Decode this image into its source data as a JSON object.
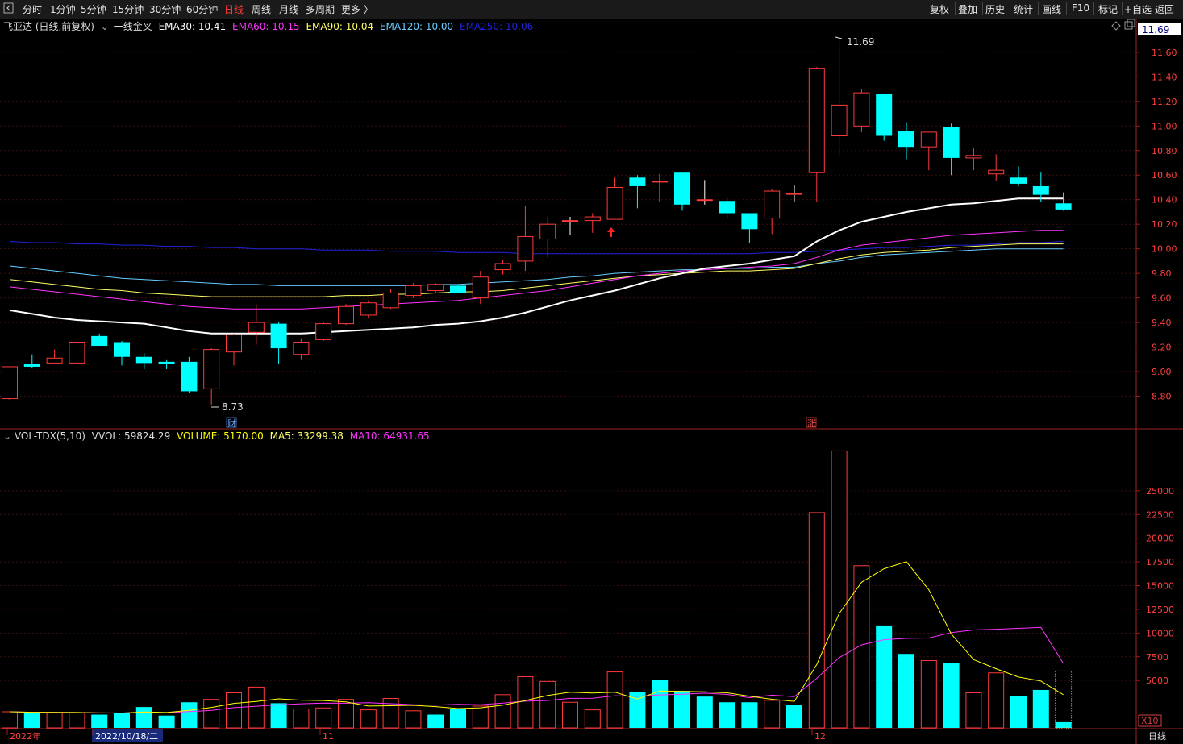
{
  "toolbar": {
    "back_icon": "square-back-icon",
    "tabs": [
      "分时",
      "1分钟",
      "5分钟",
      "15分钟",
      "30分钟",
      "60分钟",
      "日线",
      "周线",
      "月线",
      "多周期",
      "更多 〉"
    ],
    "active_tab": "日线",
    "right_buttons": [
      "复权",
      "叠加",
      "历史",
      "统计",
      "画线",
      "F10",
      "标记",
      "+自选",
      "返回"
    ]
  },
  "main_legend": {
    "stock": "飞亚达 (日线,前复权)",
    "indicator": "一线金叉",
    "ema30": "EMA30: 10.41",
    "ema60": "EMA60: 10.15",
    "ema90": "EMA90: 10.04",
    "ema120": "EMA120: 10.00",
    "ema250": "EMA250: 10.06"
  },
  "vol_legend": {
    "name": "VOL-TDX(5,10)",
    "vvol": "VVOL: 59824.29",
    "volume": "VOLUME: 5170.00",
    "ma5": "MA5: 33299.38",
    "ma10": "MA10: 64931.65"
  },
  "price_axis": {
    "current": "11.69",
    "ticks": [
      "11.60",
      "11.40",
      "11.20",
      "11.00",
      "10.80",
      "10.60",
      "10.40",
      "10.20",
      "10.00",
      "9.80",
      "9.60",
      "9.40",
      "9.20",
      "9.00",
      "8.80"
    ]
  },
  "vol_axis": {
    "ticks": [
      "25000",
      "22500",
      "20000",
      "17500",
      "15000",
      "12500",
      "10000",
      "7500",
      "5000"
    ],
    "unit": "X10"
  },
  "date_axis": {
    "labels": [
      "2022年",
      "2022/10/18/二",
      "11",
      "12"
    ],
    "period": "日线"
  },
  "annotations": {
    "high_label": "11.69",
    "low_label": "8.73",
    "marker_cai": "财",
    "marker_zhang": "涨",
    "diamond_icon": "diamond-icon",
    "window_icon": "restore-window-icon"
  },
  "colors": {
    "up": "#ff3b3b",
    "down": "#00ffff",
    "ema30": "#ffffff",
    "ema60": "#ff33ff",
    "ema90": "#ffff66",
    "ema120": "#66ccff",
    "ema250": "#2222dd",
    "ma5": "#ffff00",
    "ma10": "#ff33ff"
  },
  "chart_data": [
    {
      "type": "candlestick",
      "title": "飞亚达 (日线,前复权)",
      "ylim": [
        8.6,
        11.75
      ],
      "candles": [
        {
          "o": 8.78,
          "h": 9.04,
          "l": 8.77,
          "c": 9.04
        },
        {
          "o": 9.06,
          "h": 9.14,
          "l": 9.03,
          "c": 9.04
        },
        {
          "o": 9.07,
          "h": 9.18,
          "l": 9.07,
          "c": 9.11
        },
        {
          "o": 9.07,
          "h": 9.24,
          "l": 9.07,
          "c": 9.24
        },
        {
          "o": 9.29,
          "h": 9.31,
          "l": 9.21,
          "c": 9.21
        },
        {
          "o": 9.24,
          "h": 9.25,
          "l": 9.05,
          "c": 9.12
        },
        {
          "o": 9.12,
          "h": 9.15,
          "l": 9.02,
          "c": 9.07
        },
        {
          "o": 9.08,
          "h": 9.1,
          "l": 9.02,
          "c": 9.06
        },
        {
          "o": 9.08,
          "h": 9.12,
          "l": 8.83,
          "c": 8.84
        },
        {
          "o": 8.86,
          "h": 9.19,
          "l": 8.73,
          "c": 9.18
        },
        {
          "o": 9.16,
          "h": 9.31,
          "l": 9.05,
          "c": 9.3
        },
        {
          "o": 9.32,
          "h": 9.55,
          "l": 9.22,
          "c": 9.4
        },
        {
          "o": 9.39,
          "h": 9.4,
          "l": 9.06,
          "c": 9.19
        },
        {
          "o": 9.14,
          "h": 9.27,
          "l": 9.1,
          "c": 9.24
        },
        {
          "o": 9.26,
          "h": 9.4,
          "l": 9.25,
          "c": 9.39
        },
        {
          "o": 9.39,
          "h": 9.55,
          "l": 9.38,
          "c": 9.53
        },
        {
          "o": 9.46,
          "h": 9.58,
          "l": 9.44,
          "c": 9.56
        },
        {
          "o": 9.52,
          "h": 9.67,
          "l": 9.51,
          "c": 9.64
        },
        {
          "o": 9.62,
          "h": 9.72,
          "l": 9.6,
          "c": 9.7
        },
        {
          "o": 9.66,
          "h": 9.72,
          "l": 9.64,
          "c": 9.71
        },
        {
          "o": 9.7,
          "h": 9.71,
          "l": 9.64,
          "c": 9.64
        },
        {
          "o": 9.6,
          "h": 9.82,
          "l": 9.55,
          "c": 9.77
        },
        {
          "o": 9.83,
          "h": 9.91,
          "l": 9.79,
          "c": 9.88
        },
        {
          "o": 9.9,
          "h": 10.35,
          "l": 9.82,
          "c": 10.1
        },
        {
          "o": 10.08,
          "h": 10.26,
          "l": 9.93,
          "c": 10.2
        },
        {
          "o": 10.23,
          "h": 10.26,
          "l": 10.11,
          "c": 10.23
        },
        {
          "o": 10.23,
          "h": 10.29,
          "l": 10.13,
          "c": 10.26
        },
        {
          "o": 10.24,
          "h": 10.58,
          "l": 10.24,
          "c": 10.5
        },
        {
          "o": 10.58,
          "h": 10.6,
          "l": 10.33,
          "c": 10.51
        },
        {
          "o": 10.55,
          "h": 10.61,
          "l": 10.38,
          "c": 10.55
        },
        {
          "o": 10.62,
          "h": 10.62,
          "l": 10.31,
          "c": 10.36
        },
        {
          "o": 10.4,
          "h": 10.56,
          "l": 10.36,
          "c": 10.4
        },
        {
          "o": 10.39,
          "h": 10.42,
          "l": 10.25,
          "c": 10.29
        },
        {
          "o": 10.29,
          "h": 10.29,
          "l": 10.05,
          "c": 10.16
        },
        {
          "o": 10.25,
          "h": 10.49,
          "l": 10.12,
          "c": 10.47
        },
        {
          "o": 10.45,
          "h": 10.52,
          "l": 10.38,
          "c": 10.45
        },
        {
          "o": 10.62,
          "h": 11.48,
          "l": 10.38,
          "c": 11.47
        },
        {
          "o": 10.92,
          "h": 11.69,
          "l": 10.75,
          "c": 11.17
        },
        {
          "o": 11.0,
          "h": 11.3,
          "l": 10.95,
          "c": 11.27
        },
        {
          "o": 11.26,
          "h": 11.26,
          "l": 10.88,
          "c": 10.92
        },
        {
          "o": 10.96,
          "h": 11.03,
          "l": 10.73,
          "c": 10.83
        },
        {
          "o": 10.83,
          "h": 10.95,
          "l": 10.64,
          "c": 10.95
        },
        {
          "o": 10.99,
          "h": 11.02,
          "l": 10.6,
          "c": 10.74
        },
        {
          "o": 10.74,
          "h": 10.82,
          "l": 10.64,
          "c": 10.76
        },
        {
          "o": 10.61,
          "h": 10.77,
          "l": 10.55,
          "c": 10.64
        },
        {
          "o": 10.58,
          "h": 10.67,
          "l": 10.51,
          "c": 10.53
        },
        {
          "o": 10.51,
          "h": 10.62,
          "l": 10.38,
          "c": 10.44
        },
        {
          "o": 10.37,
          "h": 10.46,
          "l": 10.31,
          "c": 10.32
        }
      ],
      "series": [
        {
          "name": "EMA30",
          "values": [
            9.5,
            9.47,
            9.44,
            9.42,
            9.41,
            9.4,
            9.39,
            9.36,
            9.33,
            9.31,
            9.31,
            9.31,
            9.31,
            9.31,
            9.32,
            9.33,
            9.34,
            9.35,
            9.36,
            9.38,
            9.39,
            9.41,
            9.44,
            9.48,
            9.53,
            9.58,
            9.62,
            9.66,
            9.71,
            9.76,
            9.8,
            9.84,
            9.86,
            9.88,
            9.91,
            9.94,
            10.06,
            10.15,
            10.22,
            10.26,
            10.3,
            10.33,
            10.36,
            10.37,
            10.39,
            10.41,
            10.41,
            10.41
          ]
        },
        {
          "name": "EMA60",
          "values": [
            9.69,
            9.67,
            9.65,
            9.63,
            9.61,
            9.59,
            9.57,
            9.55,
            9.53,
            9.52,
            9.51,
            9.51,
            9.51,
            9.51,
            9.52,
            9.53,
            9.54,
            9.55,
            9.56,
            9.57,
            9.58,
            9.6,
            9.62,
            9.64,
            9.66,
            9.69,
            9.72,
            9.75,
            9.78,
            9.8,
            9.82,
            9.83,
            9.84,
            9.85,
            9.86,
            9.88,
            9.93,
            9.99,
            10.03,
            10.05,
            10.07,
            10.09,
            10.11,
            10.12,
            10.13,
            10.14,
            10.15,
            10.15
          ]
        },
        {
          "name": "EMA90",
          "values": [
            9.75,
            9.73,
            9.71,
            9.69,
            9.67,
            9.66,
            9.64,
            9.63,
            9.62,
            9.61,
            9.61,
            9.61,
            9.61,
            9.61,
            9.61,
            9.62,
            9.62,
            9.63,
            9.63,
            9.64,
            9.65,
            9.65,
            9.66,
            9.68,
            9.7,
            9.72,
            9.74,
            9.76,
            9.78,
            9.79,
            9.8,
            9.81,
            9.82,
            9.82,
            9.83,
            9.84,
            9.88,
            9.92,
            9.95,
            9.97,
            9.98,
            9.99,
            10.01,
            10.02,
            10.03,
            10.04,
            10.04,
            10.04
          ]
        },
        {
          "name": "EMA120",
          "values": [
            9.86,
            9.84,
            9.82,
            9.8,
            9.78,
            9.76,
            9.75,
            9.74,
            9.73,
            9.72,
            9.71,
            9.71,
            9.7,
            9.7,
            9.7,
            9.7,
            9.7,
            9.7,
            9.7,
            9.71,
            9.71,
            9.72,
            9.73,
            9.74,
            9.75,
            9.77,
            9.78,
            9.8,
            9.81,
            9.82,
            9.83,
            9.83,
            9.84,
            9.84,
            9.85,
            9.85,
            9.88,
            9.9,
            9.93,
            9.95,
            9.96,
            9.97,
            9.98,
            9.99,
            10.0,
            10.0,
            10.0,
            10.0
          ]
        },
        {
          "name": "EMA250",
          "values": [
            10.06,
            10.05,
            10.05,
            10.04,
            10.04,
            10.03,
            10.03,
            10.02,
            10.02,
            10.01,
            10.01,
            10.0,
            10.0,
            10.0,
            9.99,
            9.99,
            9.99,
            9.98,
            9.98,
            9.98,
            9.97,
            9.97,
            9.97,
            9.96,
            9.96,
            9.96,
            9.96,
            9.96,
            9.96,
            9.96,
            9.96,
            9.96,
            9.96,
            9.96,
            9.97,
            9.97,
            9.98,
            9.99,
            10.0,
            10.01,
            10.01,
            10.02,
            10.03,
            10.03,
            10.04,
            10.05,
            10.05,
            10.06
          ]
        }
      ]
    },
    {
      "type": "bar",
      "title": "VOL-TDX(5,10)",
      "ylim": [
        0,
        30000
      ],
      "values": [
        1700,
        1600,
        1600,
        1600,
        1400,
        1600,
        2200,
        1300,
        2700,
        3000,
        3700,
        4300,
        2600,
        2000,
        2100,
        3000,
        1900,
        3100,
        1800,
        1400,
        2000,
        2300,
        3500,
        5400,
        4900,
        2700,
        1900,
        5900,
        3800,
        5100,
        3900,
        3300,
        2700,
        2700,
        2900,
        2400,
        22700,
        29200,
        17100,
        10800,
        7800,
        7100,
        6800,
        3700,
        5800,
        3400,
        4000,
        600
      ],
      "up": [
        1,
        0,
        1,
        1,
        0,
        0,
        0,
        0,
        0,
        1,
        1,
        1,
        0,
        1,
        1,
        1,
        1,
        1,
        1,
        0,
        0,
        1,
        1,
        1,
        1,
        1,
        1,
        1,
        0,
        0,
        0,
        0,
        0,
        0,
        1,
        0,
        1,
        1,
        1,
        0,
        0,
        1,
        0,
        1,
        1,
        0,
        0,
        0
      ],
      "series": [
        {
          "name": "MA5",
          "values": [
            1700,
            1650,
            1630,
            1620,
            1580,
            1560,
            1680,
            1620,
            1840,
            2160,
            2580,
            2780,
            3060,
            2920,
            2880,
            2740,
            2300,
            2340,
            2380,
            2240,
            2040,
            2120,
            2400,
            2880,
            3420,
            3760,
            3680,
            3760,
            3040,
            3880,
            3840,
            3800,
            3700,
            3340,
            3020,
            2800,
            6680,
            12060,
            15360,
            16780,
            17520,
            14560,
            9900,
            7200,
            6240,
            5360,
            4940,
            3500
          ]
        },
        {
          "name": "MA10",
          "values": [
            1700,
            1650,
            1630,
            1620,
            1580,
            1570,
            1650,
            1610,
            1720,
            1840,
            2130,
            2290,
            2430,
            2540,
            2620,
            2600,
            2660,
            2550,
            2450,
            2400,
            2490,
            2440,
            2620,
            2810,
            2890,
            3110,
            3120,
            3390,
            3340,
            3480,
            3540,
            3660,
            3530,
            3190,
            3450,
            3300,
            5230,
            7400,
            8750,
            9300,
            9440,
            9480,
            10050,
            10330,
            10400,
            10500,
            10600,
            6800
          ]
        }
      ]
    }
  ]
}
